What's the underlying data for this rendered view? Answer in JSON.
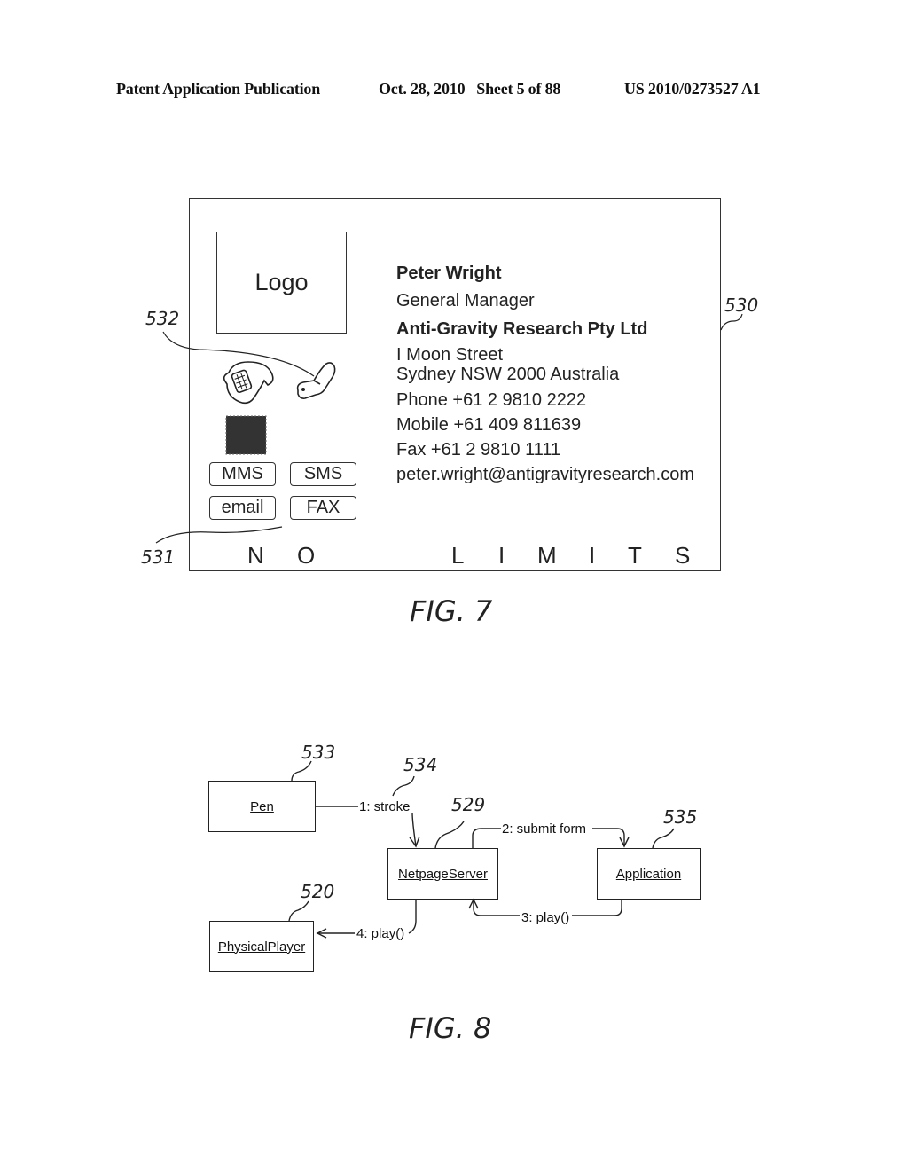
{
  "header": {
    "publication": "Patent Application Publication",
    "date_sheet": "Oct. 28, 2010   Sheet 5 of 88",
    "number": "US 2010/0273527 A1"
  },
  "fig7": {
    "caption": "FIG. 7",
    "card": {
      "logo_label": "Logo",
      "name": "Peter Wright",
      "title": "General Manager",
      "company": "Anti-Gravity Research Pty Ltd",
      "address_line1": "I Moon Street",
      "address_line2": "Sydney NSW 2000 Australia",
      "phone": "Phone +61 2 9810 2222",
      "mobile": "Mobile +61 409 811639",
      "fax": "Fax +61 2 9810 1111",
      "email": "peter.wright@antigravityresearch.com",
      "icons": [
        "desk-phone-icon",
        "mobile-phone-icon",
        "pattern-swatch-icon"
      ],
      "buttons": [
        "MMS",
        "SMS",
        "email",
        "FAX"
      ],
      "tagline_letters": [
        "N",
        "O",
        "L",
        "I",
        "M",
        "I",
        "T",
        "S"
      ]
    },
    "refs": {
      "card": "530",
      "buttons": "531",
      "phones": "532"
    }
  },
  "fig8": {
    "caption": "FIG. 8",
    "objects": {
      "pen": "Pen",
      "server": "NetpageServer",
      "application": "Application",
      "player": "PhysicalPlayer"
    },
    "messages": {
      "m1": "1: stroke",
      "m2": "2: submit form",
      "m3": "3: play()",
      "m4": "4: play()"
    },
    "refs": {
      "pen": "533",
      "stroke": "534",
      "server": "529",
      "application": "535",
      "player": "520"
    }
  }
}
